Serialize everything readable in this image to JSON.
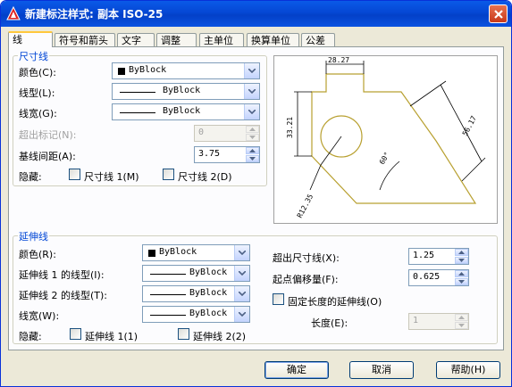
{
  "window": {
    "title": "新建标注样式: 副本 ISO-25"
  },
  "tabs": [
    "线",
    "符号和箭头",
    "文字",
    "调整",
    "主单位",
    "换算单位",
    "公差"
  ],
  "dim_lines": {
    "group_title": "尺寸线",
    "color_label": "颜色(C):",
    "color_value": "ByBlock",
    "linetype_label": "线型(L):",
    "linetype_value": "ByBlock",
    "lineweight_label": "线宽(G):",
    "lineweight_value": "ByBlock",
    "extend_ticks_label": "超出标记(N):",
    "extend_ticks_value": "0",
    "baseline_spacing_label": "基线间距(A):",
    "baseline_spacing_value": "3.75",
    "suppress_label": "隐藏:",
    "suppress_1": "尺寸线 1(M)",
    "suppress_2": "尺寸线 2(D)"
  },
  "preview": {
    "dim_top": "28.27",
    "dim_left": "33.21",
    "dim_right": "56.17",
    "dim_radius": "R12.35",
    "dim_angle": "60°"
  },
  "ext_lines": {
    "group_title": "延伸线",
    "color_label": "颜色(R):",
    "color_value": "ByBlock",
    "linetype1_label": "延伸线 1 的线型(I):",
    "linetype1_value": "ByBlock",
    "linetype2_label": "延伸线 2 的线型(T):",
    "linetype2_value": "ByBlock",
    "lineweight_label": "线宽(W):",
    "lineweight_value": "ByBlock",
    "suppress_label": "隐藏:",
    "suppress_1": "延伸线 1(1)",
    "suppress_2": "延伸线 2(2)",
    "extend_beyond_label": "超出尺寸线(X):",
    "extend_beyond_value": "1.25",
    "offset_label": "起点偏移量(F):",
    "offset_value": "0.625",
    "fixed_length_label": "固定长度的延伸线(O)",
    "length_label": "长度(E):",
    "length_value": "1"
  },
  "buttons": {
    "ok": "确定",
    "cancel": "取消",
    "help": "帮助(H)"
  },
  "colors": {
    "title_bar": "#0a5ae8",
    "group_title": "#0046d5",
    "preview_line": "#b8a030"
  }
}
